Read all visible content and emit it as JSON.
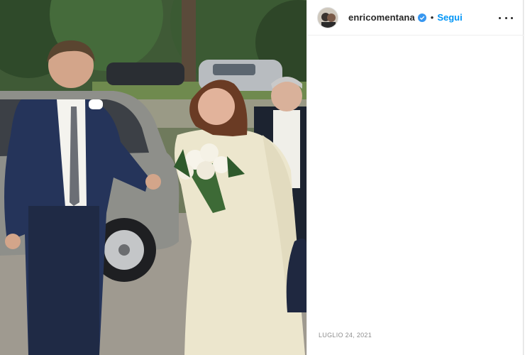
{
  "post": {
    "photo_alt": "",
    "header": {
      "username": "enricomentana",
      "separator": "•",
      "follow_label": "Segui",
      "verified_icon": "verified-badge-icon",
      "more_icon": "more-options-icon"
    },
    "date": "LUGLIO 24, 2021"
  },
  "colors": {
    "follow_blue": "#0095f6",
    "verified_blue": "#3897f0",
    "text_dark": "#262626",
    "text_muted": "#8e8e8e",
    "border": "#efefef"
  }
}
